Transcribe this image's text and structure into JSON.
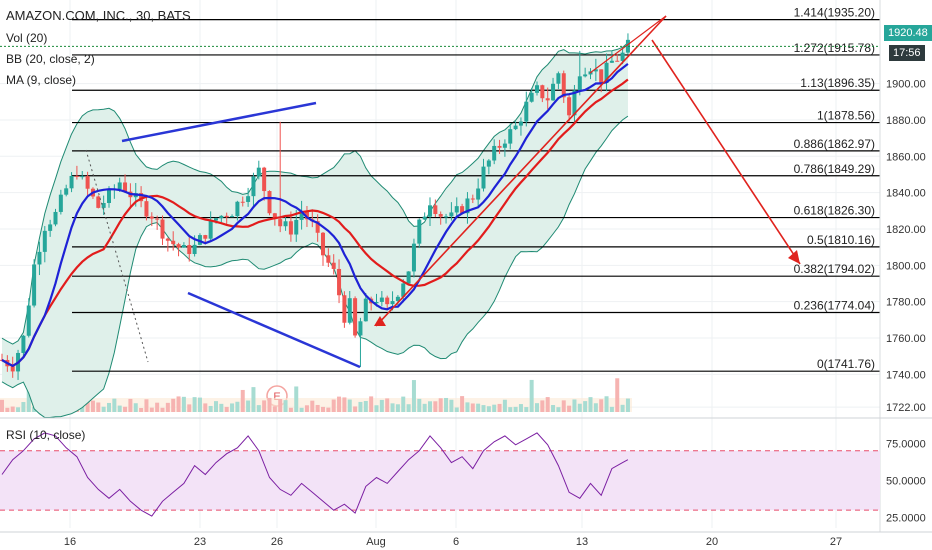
{
  "symbol_header": "AMAZON.COM, INC., 30, BATS",
  "indicators": {
    "vol": "Vol (20)",
    "bb": "BB (20, close, 2)",
    "ma": "MA (9, close)",
    "rsi": "RSI (10, close)"
  },
  "price_badge": {
    "value": "1920.48",
    "countdown": "17:56",
    "color": "#2e3a3d"
  },
  "earnings_marker": "E",
  "colors": {
    "up": "#26a69a",
    "down": "#ef5350",
    "ma": "#1e22d6",
    "bb_mid": "#e21c1c",
    "bb_band": "#1f8a73",
    "bb_fill": "#dff0ea",
    "trend": "#2a36d6",
    "arrow": "#e0231e",
    "rsi_line": "#7b1fa2",
    "rsi_fill": "#f3e3f7",
    "rsi_bound": "#e84b6a",
    "fib": "#000000"
  },
  "chart_data": {
    "type": "candlestick",
    "title": "AMAZON.COM, INC., 30, BATS",
    "x_ticks": [
      "16",
      "23",
      "26",
      "Aug",
      "6",
      "13",
      "20",
      "27"
    ],
    "price_axis": {
      "ylim": [
        1716,
        1946
      ],
      "ticks": [
        "1722.00",
        "1740.00",
        "1760.00",
        "1780.00",
        "1800.00",
        "1820.00",
        "1840.00",
        "1860.00",
        "1880.00",
        "1900.00"
      ]
    },
    "fibonacci_levels": [
      {
        "label": "0(1741.76)",
        "value": 1741.76
      },
      {
        "label": "0.236(1774.04)",
        "value": 1774.04
      },
      {
        "label": "0.382(1794.02)",
        "value": 1794.02
      },
      {
        "label": "0.5(1810.16)",
        "value": 1810.16
      },
      {
        "label": "0.618(1826.30)",
        "value": 1826.3
      },
      {
        "label": "0.786(1849.29)",
        "value": 1849.29
      },
      {
        "label": "0.886(1862.97)",
        "value": 1862.97
      },
      {
        "label": "1(1878.56)",
        "value": 1878.56
      },
      {
        "label": "1.13(1896.35)",
        "value": 1896.35
      },
      {
        "label": "1.272(1915.78)",
        "value": 1915.78
      },
      {
        "label": "1.414(1935.20)",
        "value": 1935.2
      }
    ],
    "last_price": 1920.48,
    "price_path": [
      [
        0,
        1748
      ],
      [
        2,
        1745
      ],
      [
        4,
        1760
      ],
      [
        6,
        1800
      ],
      [
        8,
        1822
      ],
      [
        10,
        1828
      ],
      [
        12,
        1842
      ],
      [
        14,
        1852
      ],
      [
        15,
        1846
      ],
      [
        18,
        1832
      ],
      [
        20,
        1838
      ],
      [
        22,
        1846
      ],
      [
        25,
        1836
      ],
      [
        28,
        1828
      ],
      [
        31,
        1814
      ],
      [
        34,
        1808
      ],
      [
        36,
        1810
      ],
      [
        40,
        1826
      ],
      [
        43,
        1830
      ],
      [
        46,
        1842
      ],
      [
        48,
        1852
      ],
      [
        50,
        1832
      ],
      [
        52,
        1822
      ],
      [
        54,
        1820
      ],
      [
        56,
        1830
      ],
      [
        58,
        1822
      ],
      [
        60,
        1806
      ],
      [
        62,
        1796
      ],
      [
        64,
        1772
      ],
      [
        65,
        1778
      ],
      [
        66,
        1760
      ],
      [
        68,
        1778
      ],
      [
        70,
        1782
      ],
      [
        72,
        1776
      ],
      [
        74,
        1786
      ],
      [
        76,
        1798
      ],
      [
        78,
        1822
      ],
      [
        80,
        1836
      ],
      [
        82,
        1828
      ],
      [
        84,
        1826
      ],
      [
        86,
        1832
      ],
      [
        88,
        1838
      ],
      [
        90,
        1852
      ],
      [
        92,
        1862
      ],
      [
        94,
        1870
      ],
      [
        96,
        1876
      ],
      [
        98,
        1888
      ],
      [
        100,
        1896
      ],
      [
        102,
        1892
      ],
      [
        104,
        1906
      ],
      [
        106,
        1882
      ],
      [
        108,
        1908
      ],
      [
        110,
        1910
      ],
      [
        112,
        1903
      ],
      [
        114,
        1912
      ],
      [
        116,
        1916
      ],
      [
        117,
        1920.48
      ]
    ],
    "rsi": {
      "label": "RSI (10, close)",
      "ylim": [
        18,
        88
      ],
      "ticks": [
        "75.0000",
        "50.0000",
        "25.0000"
      ],
      "upper": 70,
      "lower": 30,
      "values": [
        [
          0,
          54
        ],
        [
          2,
          64
        ],
        [
          4,
          70
        ],
        [
          6,
          78
        ],
        [
          8,
          82
        ],
        [
          10,
          80
        ],
        [
          12,
          72
        ],
        [
          14,
          66
        ],
        [
          16,
          52
        ],
        [
          18,
          44
        ],
        [
          20,
          38
        ],
        [
          22,
          44
        ],
        [
          24,
          36
        ],
        [
          26,
          30
        ],
        [
          28,
          26
        ],
        [
          30,
          36
        ],
        [
          32,
          42
        ],
        [
          34,
          48
        ],
        [
          36,
          60
        ],
        [
          38,
          54
        ],
        [
          40,
          62
        ],
        [
          42,
          68
        ],
        [
          44,
          72
        ],
        [
          46,
          80
        ],
        [
          48,
          70
        ],
        [
          50,
          52
        ],
        [
          52,
          44
        ],
        [
          54,
          40
        ],
        [
          56,
          48
        ],
        [
          58,
          42
        ],
        [
          60,
          36
        ],
        [
          62,
          30
        ],
        [
          64,
          34
        ],
        [
          66,
          28
        ],
        [
          68,
          46
        ],
        [
          70,
          52
        ],
        [
          72,
          48
        ],
        [
          74,
          56
        ],
        [
          76,
          64
        ],
        [
          78,
          70
        ],
        [
          80,
          80
        ],
        [
          82,
          72
        ],
        [
          84,
          62
        ],
        [
          86,
          66
        ],
        [
          88,
          58
        ],
        [
          90,
          70
        ],
        [
          92,
          76
        ],
        [
          94,
          80
        ],
        [
          96,
          74
        ],
        [
          98,
          78
        ],
        [
          100,
          82
        ],
        [
          102,
          74
        ],
        [
          104,
          60
        ],
        [
          106,
          42
        ],
        [
          108,
          38
        ],
        [
          110,
          48
        ],
        [
          112,
          40
        ],
        [
          114,
          58
        ],
        [
          116,
          62
        ],
        [
          117,
          64
        ]
      ]
    }
  }
}
